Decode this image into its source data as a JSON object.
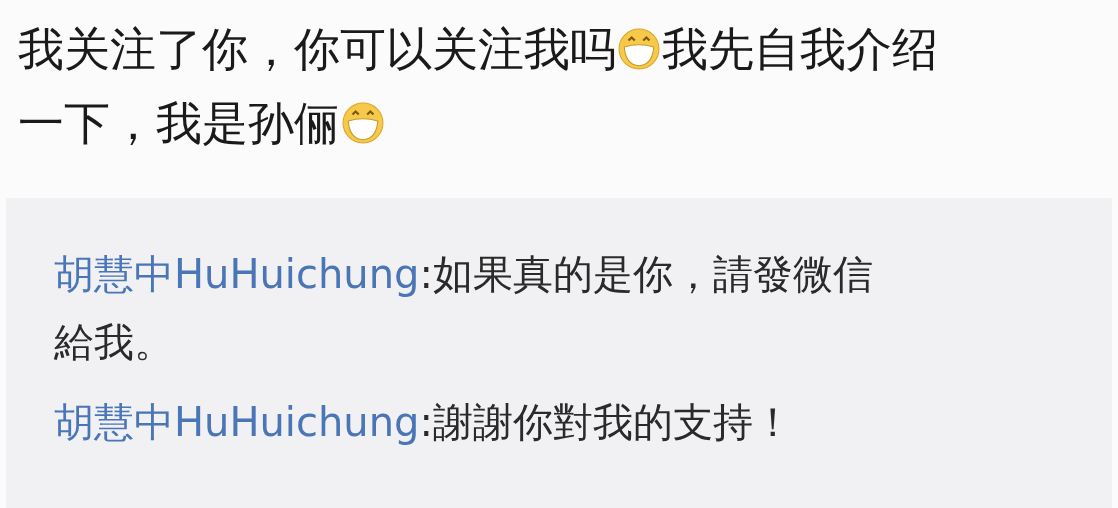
{
  "post": {
    "lines": [
      [
        {
          "kind": "text",
          "text": "我关注了你，你可以关注我吗"
        },
        {
          "kind": "emoji"
        },
        {
          "kind": "text",
          "text": "我先自我介绍"
        }
      ],
      [
        {
          "kind": "text",
          "text": "一下，我是孙俪"
        },
        {
          "kind": "emoji"
        }
      ]
    ]
  },
  "comments": [
    {
      "user": "胡慧中HuHuichung",
      "lines": [
        ":如果真的是你，請發微信",
        "給我。"
      ]
    },
    {
      "user": "胡慧中HuHuichung",
      "lines": [
        ":謝謝你對我的支持！"
      ]
    }
  ]
}
